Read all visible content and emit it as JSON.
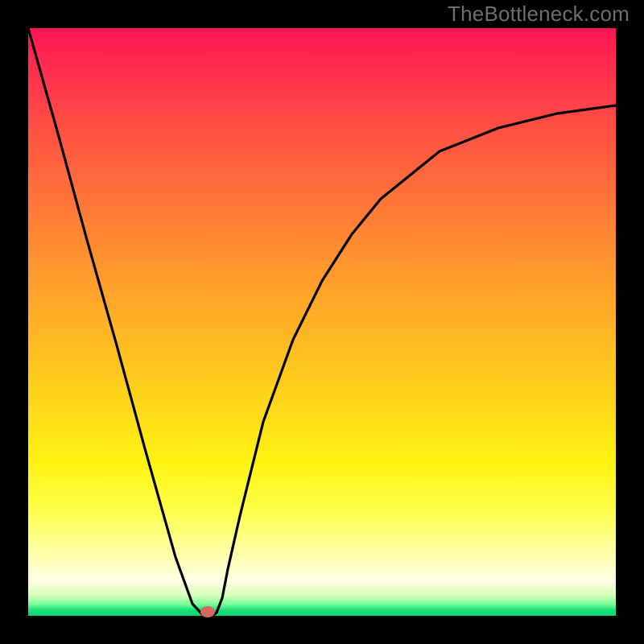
{
  "watermark": "TheBottleneck.com",
  "colors": {
    "curve_stroke": "#000000",
    "dot": "#d6685f",
    "background": "#000000"
  },
  "chart_data": {
    "type": "line",
    "title": "",
    "xlabel": "",
    "ylabel": "",
    "xlim": [
      0,
      1
    ],
    "ylim": [
      0,
      1
    ],
    "series": [
      {
        "name": "curve",
        "x": [
          0.0,
          0.05,
          0.1,
          0.15,
          0.2,
          0.25,
          0.28,
          0.3,
          0.31,
          0.32,
          0.33,
          0.34,
          0.36,
          0.4,
          0.45,
          0.5,
          0.55,
          0.6,
          0.7,
          0.8,
          0.9,
          1.0
        ],
        "y": [
          1.0,
          0.82,
          0.64,
          0.46,
          0.28,
          0.1,
          0.02,
          0.0,
          0.0,
          0.005,
          0.03,
          0.08,
          0.17,
          0.33,
          0.47,
          0.57,
          0.65,
          0.71,
          0.79,
          0.83,
          0.855,
          0.868
        ]
      }
    ],
    "marker": {
      "x": 0.305,
      "y": 0.0
    },
    "legend": false,
    "grid": false
  }
}
